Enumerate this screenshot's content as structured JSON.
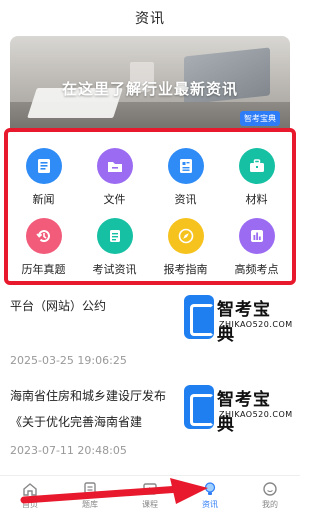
{
  "header": {
    "title": "资讯"
  },
  "banner": {
    "slogan": "在这里了解行业最新资讯",
    "badge": "智考宝典"
  },
  "grid": {
    "items": [
      {
        "label": "新闻",
        "icon": "news-icon",
        "color": "#2f8cf6"
      },
      {
        "label": "文件",
        "icon": "folder-icon",
        "color": "#9b6cf2"
      },
      {
        "label": "资讯",
        "icon": "document-icon",
        "color": "#2f8cf6"
      },
      {
        "label": "材料",
        "icon": "briefcase-icon",
        "color": "#16c0a3"
      },
      {
        "label": "历年真题",
        "icon": "history-icon",
        "color": "#f25b7a"
      },
      {
        "label": "考试资讯",
        "icon": "scroll-icon",
        "color": "#16c0a3"
      },
      {
        "label": "报考指南",
        "icon": "compass-icon",
        "color": "#f6c21e"
      },
      {
        "label": "高频考点",
        "icon": "chart-icon",
        "color": "#9b6cf2"
      }
    ]
  },
  "news": [
    {
      "text": "平台（网站）公约",
      "date": "2025-03-25 19:06:25",
      "logo_brand": "智考宝典",
      "logo_domain": "ZHIKAO520.COM"
    },
    {
      "text": "海南省住房和城乡建设厅发布《关于优化完善海南省建",
      "date": "2023-07-11 20:48:05",
      "logo_brand": "智考宝典",
      "logo_domain": "ZHIKAO520.COM"
    }
  ],
  "tabbar": {
    "items": [
      {
        "label": "首页",
        "icon": "home-icon"
      },
      {
        "label": "题库",
        "icon": "question-bank-icon"
      },
      {
        "label": "课程",
        "icon": "course-icon"
      },
      {
        "label": "资讯",
        "icon": "lightbulb-icon",
        "active": true
      },
      {
        "label": "我的",
        "icon": "profile-icon"
      }
    ]
  },
  "colors": {
    "accent": "#2f7df6",
    "highlight": "#e8192c"
  }
}
